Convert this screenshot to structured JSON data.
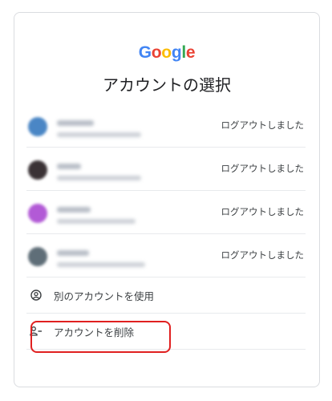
{
  "logo": {
    "letters": [
      {
        "char": "G",
        "color": "#4285F4"
      },
      {
        "char": "o",
        "color": "#EA4335"
      },
      {
        "char": "o",
        "color": "#FBBC05"
      },
      {
        "char": "g",
        "color": "#4285F4"
      },
      {
        "char": "l",
        "color": "#34A853"
      },
      {
        "char": "e",
        "color": "#EA4335"
      }
    ]
  },
  "title": "アカウントの選択",
  "accounts": [
    {
      "status": "ログアウトしました",
      "avatar_color": "#4a86c5"
    },
    {
      "status": "ログアウトしました",
      "avatar_color": "#3a3235"
    },
    {
      "status": "ログアウトしました",
      "avatar_color": "#b25ad6"
    },
    {
      "status": "ログアウトしました",
      "avatar_color": "#5f6e78"
    }
  ],
  "actions": {
    "use_other": {
      "label": "別のアカウントを使用",
      "icon": "account-circle-icon"
    },
    "remove": {
      "label": "アカウントを削除",
      "icon": "person-remove-icon"
    }
  },
  "colors": {
    "highlight": "#e02020",
    "divider": "#e8eaed"
  }
}
